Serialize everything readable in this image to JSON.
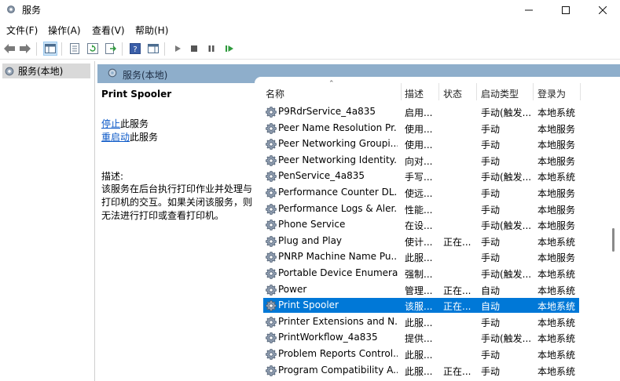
{
  "window": {
    "title": "服务"
  },
  "menu": {
    "items": [
      "文件(F)",
      "操作(A)",
      "查看(V)",
      "帮助(H)"
    ]
  },
  "tree": {
    "root_label": "服务(本地)"
  },
  "header": {
    "label": "服务(本地)"
  },
  "detail": {
    "service_name": "Print Spooler",
    "stop_link": "停止",
    "stop_suffix": "此服务",
    "restart_link": "重启动",
    "restart_suffix": "此服务",
    "desc_label": "描述:",
    "desc_text": "该服务在后台执行打印作业并处理与打印机的交互。如果关闭该服务，则无法进行打印或查看打印机。"
  },
  "list": {
    "columns": {
      "name": "名称",
      "desc": "描述",
      "state": "状态",
      "startup": "启动类型",
      "logon": "登录为"
    },
    "rows": [
      {
        "name": "P9RdrService_4a835",
        "desc": "启用...",
        "state": "",
        "startup": "手动(触发...",
        "logon": "本地系统"
      },
      {
        "name": "Peer Name Resolution Pr...",
        "desc": "使用...",
        "state": "",
        "startup": "手动",
        "logon": "本地服务"
      },
      {
        "name": "Peer Networking Groupi...",
        "desc": "使用...",
        "state": "",
        "startup": "手动",
        "logon": "本地服务"
      },
      {
        "name": "Peer Networking Identity...",
        "desc": "向对...",
        "state": "",
        "startup": "手动",
        "logon": "本地服务"
      },
      {
        "name": "PenService_4a835",
        "desc": "手写...",
        "state": "",
        "startup": "手动(触发...",
        "logon": "本地系统"
      },
      {
        "name": "Performance Counter DL...",
        "desc": "使远...",
        "state": "",
        "startup": "手动",
        "logon": "本地服务"
      },
      {
        "name": "Performance Logs & Aler...",
        "desc": "性能...",
        "state": "",
        "startup": "手动",
        "logon": "本地服务"
      },
      {
        "name": "Phone Service",
        "desc": "在设...",
        "state": "",
        "startup": "手动(触发...",
        "logon": "本地服务"
      },
      {
        "name": "Plug and Play",
        "desc": "使计...",
        "state": "正在...",
        "startup": "手动",
        "logon": "本地系统"
      },
      {
        "name": "PNRP Machine Name Pu...",
        "desc": "此服...",
        "state": "",
        "startup": "手动",
        "logon": "本地服务"
      },
      {
        "name": "Portable Device Enumera...",
        "desc": "强制...",
        "state": "",
        "startup": "手动(触发...",
        "logon": "本地系统"
      },
      {
        "name": "Power",
        "desc": "管理...",
        "state": "正在...",
        "startup": "自动",
        "logon": "本地系统"
      },
      {
        "name": "Print Spooler",
        "desc": "该服...",
        "state": "正在...",
        "startup": "自动",
        "logon": "本地系统",
        "selected": true
      },
      {
        "name": "Printer Extensions and N...",
        "desc": "此服...",
        "state": "",
        "startup": "手动",
        "logon": "本地系统"
      },
      {
        "name": "PrintWorkflow_4a835",
        "desc": "提供...",
        "state": "",
        "startup": "手动(触发...",
        "logon": "本地系统"
      },
      {
        "name": "Problem Reports Control...",
        "desc": "此服...",
        "state": "",
        "startup": "手动",
        "logon": "本地系统"
      },
      {
        "name": "Program Compatibility A...",
        "desc": "此服...",
        "state": "正在...",
        "startup": "手动",
        "logon": "本地系统"
      }
    ]
  },
  "colors": {
    "selection": "#0078d7",
    "header_band": "#8eaecb",
    "link": "#0b58c7"
  }
}
